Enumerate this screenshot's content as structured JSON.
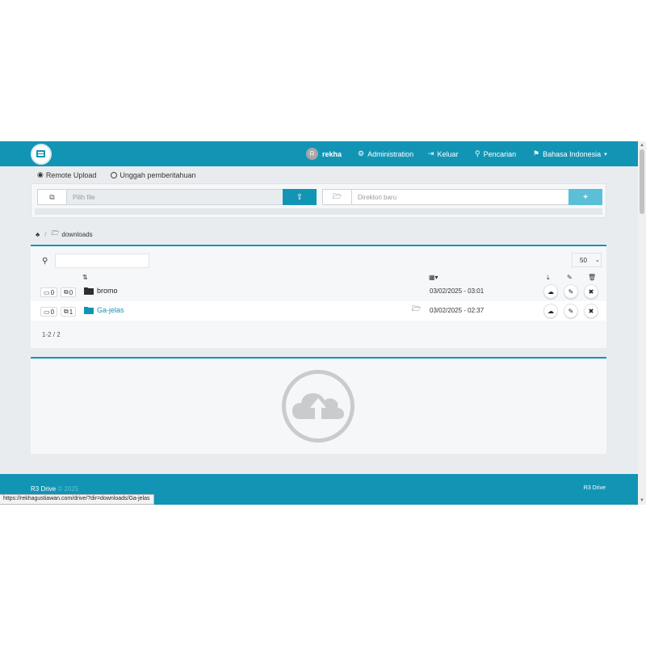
{
  "navbar": {
    "user_initial": "R",
    "user_name": "rekha",
    "administration": "Administration",
    "logout": "Keluar",
    "search": "Pencarian",
    "language": "Bahasa Indonesia"
  },
  "upload_options": {
    "remote_upload": "Remote Upload",
    "notify": "Unggah pemberitahuan"
  },
  "upload_panel": {
    "file_placeholder": "Pilih file",
    "dir_placeholder": "Direktori baru"
  },
  "breadcrumb": {
    "folder": "downloads"
  },
  "file_list": {
    "page_size": "50",
    "rows": [
      {
        "folders": "0",
        "files": "0",
        "name": "bromo",
        "date": "03/02/2025 - 03:01"
      },
      {
        "folders": "0",
        "files": "1",
        "name": "Ga-jelas",
        "date": "03/02/2025 - 02:37"
      }
    ],
    "summary": "1-2 / 2"
  },
  "footer": {
    "brand": "R3 Drive",
    "year": "© 2025",
    "right": "R3 Drive"
  },
  "status_url": "https://rekhagustiawan.com/drive/?dir=downloads/Ga-jelas",
  "colors": {
    "accent": "#1295b5",
    "link": "#1295b5"
  }
}
